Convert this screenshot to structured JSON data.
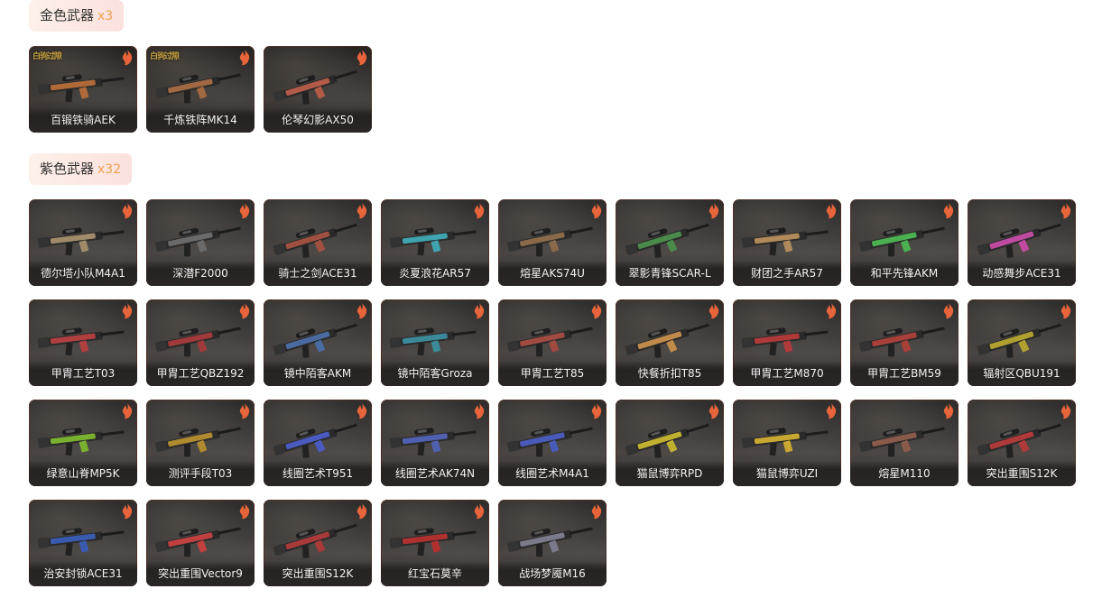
{
  "sections": [
    {
      "title": "金色武器",
      "count": "x3",
      "items": [
        {
          "name": "百锻铁骑AEK",
          "accent": "#b06a3a",
          "logo": "白驹过隙"
        },
        {
          "name": "千炼铁阵MK14",
          "accent": "#a26842",
          "logo": "白驹过隙"
        },
        {
          "name": "伦琴幻影AX50",
          "accent": "#b45a48",
          "logo": ""
        }
      ]
    },
    {
      "title": "紫色武器",
      "count": "x32",
      "items": [
        {
          "name": "德尔塔小队M4A1",
          "accent": "#a08a6a"
        },
        {
          "name": "深潜F2000",
          "accent": "#6a6a6a"
        },
        {
          "name": "骑士之剑ACE31",
          "accent": "#a05040"
        },
        {
          "name": "炎夏浪花AR57",
          "accent": "#3fa3b0"
        },
        {
          "name": "熔星AKS74U",
          "accent": "#8a6a4a"
        },
        {
          "name": "翠影青锋SCAR-L",
          "accent": "#4a8a4a"
        },
        {
          "name": "财团之手AR57",
          "accent": "#b08a5a"
        },
        {
          "name": "和平先锋AKM",
          "accent": "#4ab050"
        },
        {
          "name": "动感舞步ACE31",
          "accent": "#c04aa0"
        },
        {
          "name": "甲胄工艺T03",
          "accent": "#b04040"
        },
        {
          "name": "甲胄工艺QBZ192",
          "accent": "#a03a3a"
        },
        {
          "name": "镜中陌客AKM",
          "accent": "#4a6aa0"
        },
        {
          "name": "镜中陌客Groza",
          "accent": "#3a8a9a"
        },
        {
          "name": "甲胄工艺T85",
          "accent": "#a04a40"
        },
        {
          "name": "快餐折扣T85",
          "accent": "#c08a4a"
        },
        {
          "name": "甲胄工艺M870",
          "accent": "#b03a3a"
        },
        {
          "name": "甲胄工艺BM59",
          "accent": "#a8403a"
        },
        {
          "name": "辐射区QBU191",
          "accent": "#b0a030"
        },
        {
          "name": "绿意山脊MP5K",
          "accent": "#7ab030"
        },
        {
          "name": "测评手段T03",
          "accent": "#b08a30"
        },
        {
          "name": "线圈艺术T951",
          "accent": "#4a5ac0"
        },
        {
          "name": "线圈艺术AK74N",
          "accent": "#5060b0"
        },
        {
          "name": "线圈艺术M4A1",
          "accent": "#4a5ab8"
        },
        {
          "name": "猫鼠博弈RPD",
          "accent": "#c0b030"
        },
        {
          "name": "猫鼠博弈UZI",
          "accent": "#c8a830"
        },
        {
          "name": "熔星M110",
          "accent": "#8a5a4a"
        },
        {
          "name": "突出重围S12K",
          "accent": "#b03a3a"
        },
        {
          "name": "治安封锁ACE31",
          "accent": "#3a5ab0"
        },
        {
          "name": "突出重围Vector9",
          "accent": "#c04040"
        },
        {
          "name": "突出重围S12K",
          "accent": "#a83a3a"
        },
        {
          "name": "红宝石莫辛",
          "accent": "#b03030"
        },
        {
          "name": "战场梦魇M16",
          "accent": "#7a7a8a"
        }
      ]
    }
  ],
  "colors": {
    "header_bg": "#fbe1dd",
    "count": "#f0a050",
    "badge": "#e8643a"
  }
}
